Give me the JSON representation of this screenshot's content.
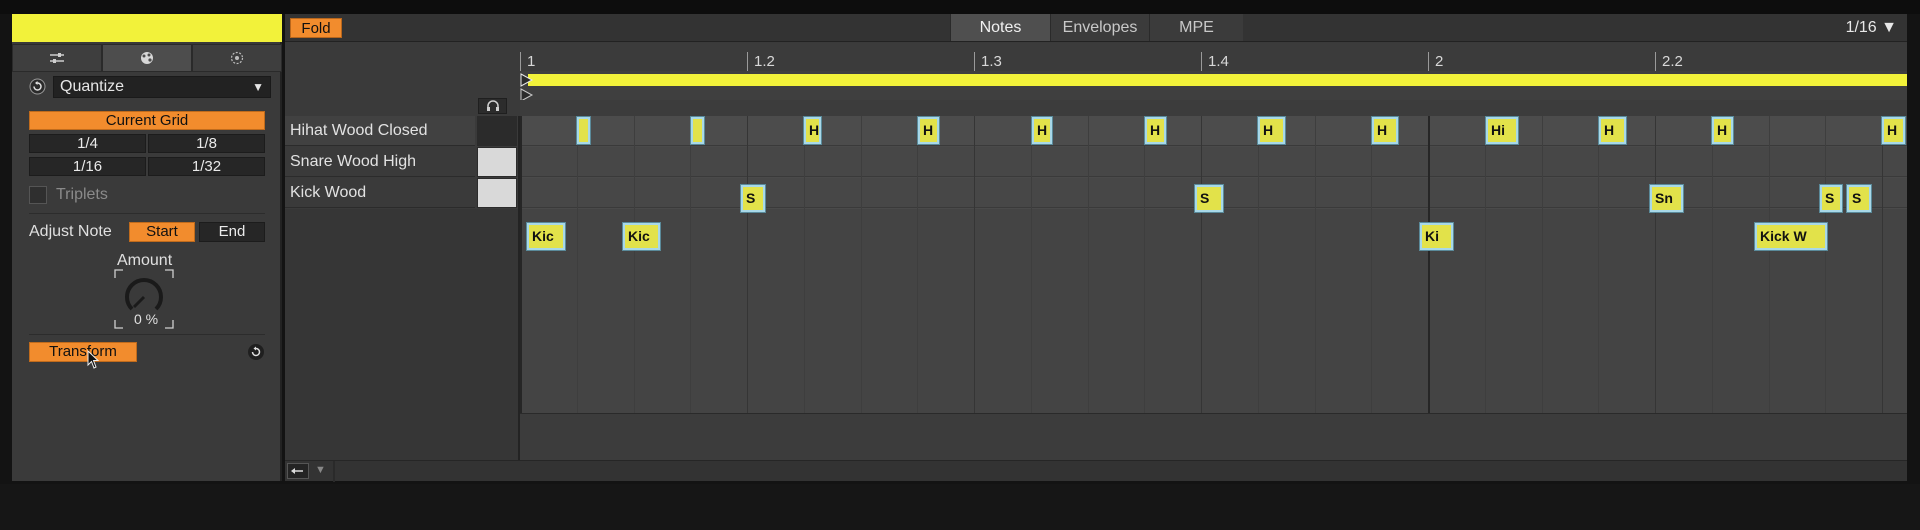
{
  "left_panel": {
    "clip_color": "#f2f23a",
    "tabs": [
      {
        "icon": "sliders-icon"
      },
      {
        "icon": "palette-icon"
      },
      {
        "icon": "target-icon"
      }
    ],
    "transform_select": {
      "value": "Quantize"
    },
    "current_grid_label": "Current Grid",
    "grid_options": [
      "1/4",
      "1/8",
      "1/16",
      "1/32"
    ],
    "triplets_label": "Triplets",
    "adjust_note_label": "Adjust Note",
    "start_label": "Start",
    "end_label": "End",
    "amount_label": "Amount",
    "amount_value": "0 %",
    "transform_button": "Transform"
  },
  "editor": {
    "fold_label": "Fold",
    "tabs": [
      "Notes",
      "Envelopes",
      "MPE"
    ],
    "active_tab": "Notes",
    "grid_value": "1/16",
    "ruler": [
      "1",
      "1.2",
      "1.3",
      "1.4",
      "2",
      "2.2"
    ],
    "rows": [
      {
        "name": "Hihat Wood Closed"
      },
      {
        "name": "Snare Wood High"
      },
      {
        "name": "Kick Wood"
      }
    ],
    "notes": {
      "hihat": [
        "",
        "",
        "H",
        "H",
        "H",
        "H",
        "H",
        "H",
        "Hi",
        "H",
        "H",
        "H"
      ],
      "snare": [
        "S",
        "S",
        "Sn",
        "S",
        "S"
      ],
      "kick": [
        "Kic",
        "Kic",
        "Ki",
        "Kick W"
      ]
    }
  },
  "colors": {
    "accent_orange": "#f28c2d",
    "note_yellow": "#e2e24a",
    "loop_yellow": "#f2f23a"
  }
}
